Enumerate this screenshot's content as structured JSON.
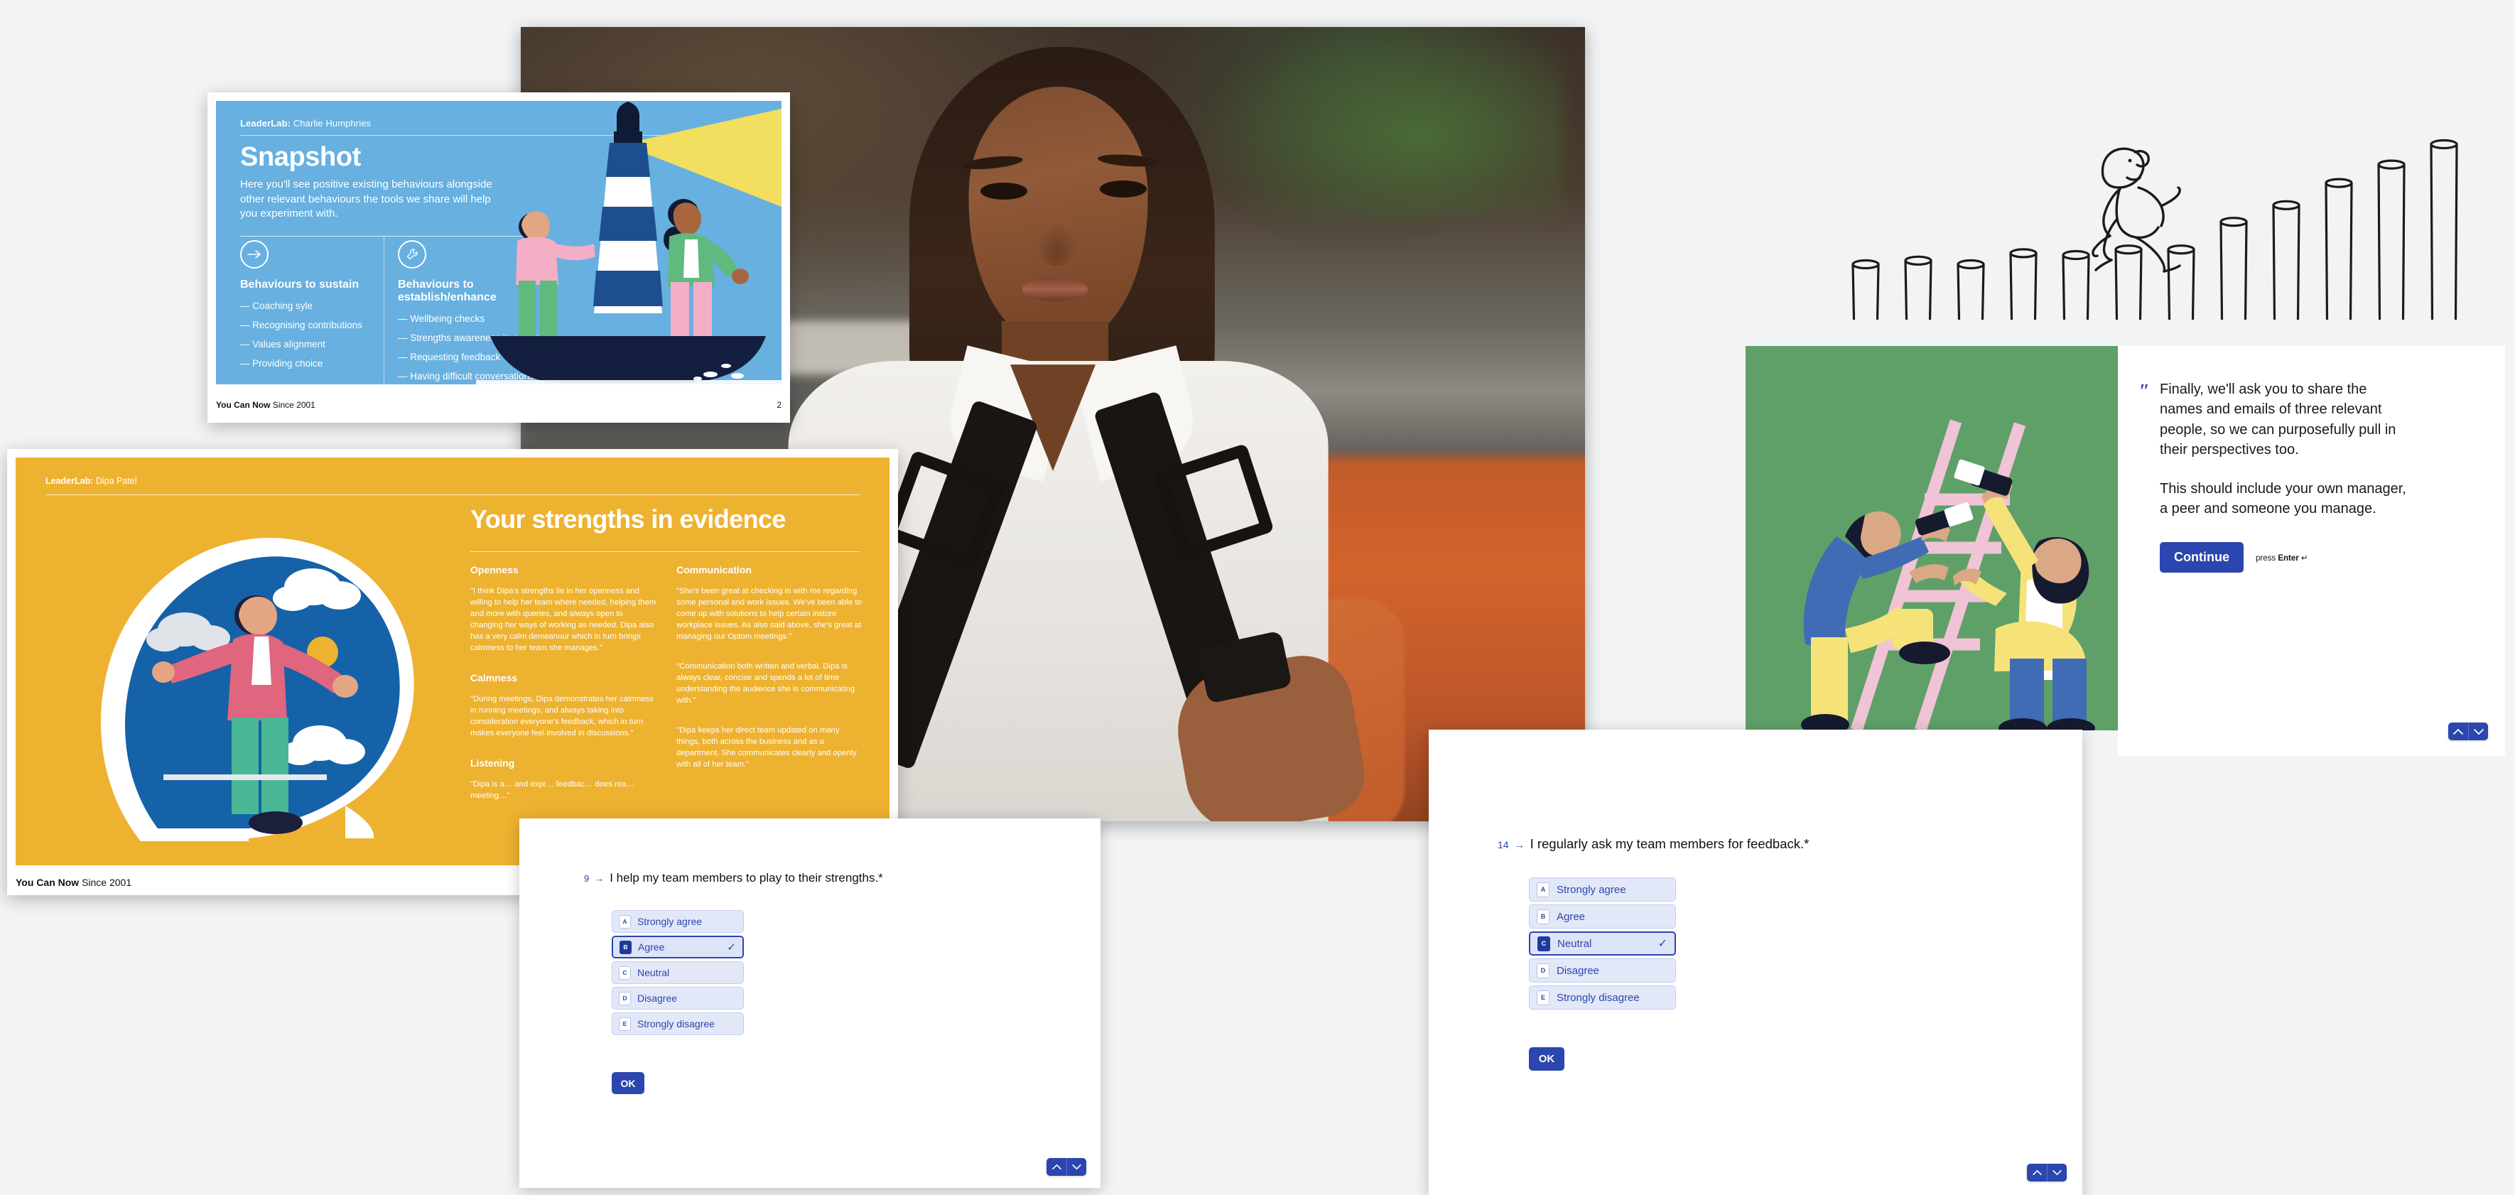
{
  "background_color": "#f1f3f4",
  "slide_blue": {
    "brand_bold": "LeaderLab:",
    "brand_name": " Charlie Humphries",
    "title": "Snapshot",
    "subtitle": "Here you'll see positive existing behaviours alongside other relevant behaviours the tools we share will help you experiment with.",
    "col_left_heading": "Behaviours to sustain",
    "col_left_items": [
      "Coaching syle",
      "Recognising contributions",
      "Values alignment",
      "Providing choice"
    ],
    "col_right_heading": "Behaviours to establish/enhance",
    "col_right_items": [
      "Wellbeing checks",
      "Strengths awareness in others",
      "Requesting feedback",
      "Having difficult conversations"
    ],
    "footer_bold": "You Can Now",
    "footer_rest": " Since 2001",
    "page_number": "2",
    "bg_color": "#67b0e0",
    "left_icon": "arrow-right-icon",
    "right_icon": "wrench-icon"
  },
  "slide_yellow": {
    "brand_bold": "LeaderLab:",
    "brand_name": " Dipa Patel",
    "title": "Your strengths in evidence",
    "bg_color": "#eeb231",
    "sections_left": [
      {
        "heading": "Openness",
        "body": "\"I think Dipa's strengths lie in her openness and willing to help her team where needed, helping them and more with queries, and always open to changing her ways of working as needed. Dipa also has a very calm demeanour which in turn brings calmness to her team she manages.\""
      },
      {
        "heading": "Calmness",
        "body": "\"During meetings, Dipa demonstrates her calmness in running meetings, and always taking into consideration everyone's feedback, which in turn makes everyone feel involved in discussions.\""
      },
      {
        "heading": "Listening",
        "body": "\"Dipa is a… and expr… feedbac… does rea… meeting…\""
      }
    ],
    "sections_right": [
      {
        "heading": "Communication",
        "paragraphs": [
          "\"She's been great at checking in with me regarding some personal and work issues. We've been able to come up with solutions to help certain instore workplace issues. As also said above, she's great at managing our Optom meetings.\"",
          "\"Communication both written and verbal. Dipa is always clear, concise and spends a lot of time understanding the audience she is communicating with.\"",
          "\"Dipa keeps her direct team updated on many things, both across the business and as a department. She communicates clearly and openly with all of her team.\""
        ]
      }
    ],
    "footer_bold": "You Can Now",
    "footer_rest": " Since 2001"
  },
  "photo": {
    "alt": "smiling-woman-portrait-photo"
  },
  "panel_green": {
    "alt": "two-people-painting-a-ladder-illustration",
    "bg_color": "#5fa068"
  },
  "panel_right": {
    "quote_mark": "″",
    "paragraph_1": "Finally, we'll ask you to share the names and emails of three relevant people, so we can purposefully pull in their perspectives too.",
    "paragraph_2": "This should include your own manager, a peer and someone you manage.",
    "continue_label": "Continue",
    "hint_prefix": "press ",
    "hint_key": "Enter",
    "hint_suffix": " ↵",
    "accent_color": "#2b46ae",
    "nav_up_icon": "chevron-up-icon",
    "nav_down_icon": "chevron-down-icon"
  },
  "card_q9": {
    "number": "9",
    "arrow": "→",
    "question": "I help my team members to play to their strengths.*",
    "options": [
      {
        "key": "A",
        "label": "Strongly agree",
        "selected": false
      },
      {
        "key": "B",
        "label": "Agree",
        "selected": true
      },
      {
        "key": "C",
        "label": "Neutral",
        "selected": false
      },
      {
        "key": "D",
        "label": "Disagree",
        "selected": false
      },
      {
        "key": "E",
        "label": "Strongly disagree",
        "selected": false
      }
    ],
    "selected_index": 1,
    "tick": "✓",
    "ok_label": "OK",
    "nav_up_icon": "chevron-up-icon",
    "nav_down_icon": "chevron-down-icon"
  },
  "card_q14": {
    "number": "14",
    "arrow": "→",
    "question": "I regularly ask my team members for feedback.*",
    "options": [
      {
        "key": "A",
        "label": "Strongly agree",
        "selected": false
      },
      {
        "key": "B",
        "label": "Agree",
        "selected": false
      },
      {
        "key": "C",
        "label": "Neutral",
        "selected": true
      },
      {
        "key": "D",
        "label": "Disagree",
        "selected": false
      },
      {
        "key": "E",
        "label": "Strongly disagree",
        "selected": false
      }
    ],
    "selected_index": 2,
    "tick": "✓",
    "ok_label": "OK",
    "nav_up_icon": "chevron-up-icon",
    "nav_down_icon": "chevron-down-icon"
  },
  "sketch": {
    "alt": "stick-figure-running-over-rising-bars-sketch",
    "bars": [
      30,
      32,
      30,
      36,
      35,
      38,
      38,
      53,
      62,
      74,
      84,
      95
    ]
  }
}
